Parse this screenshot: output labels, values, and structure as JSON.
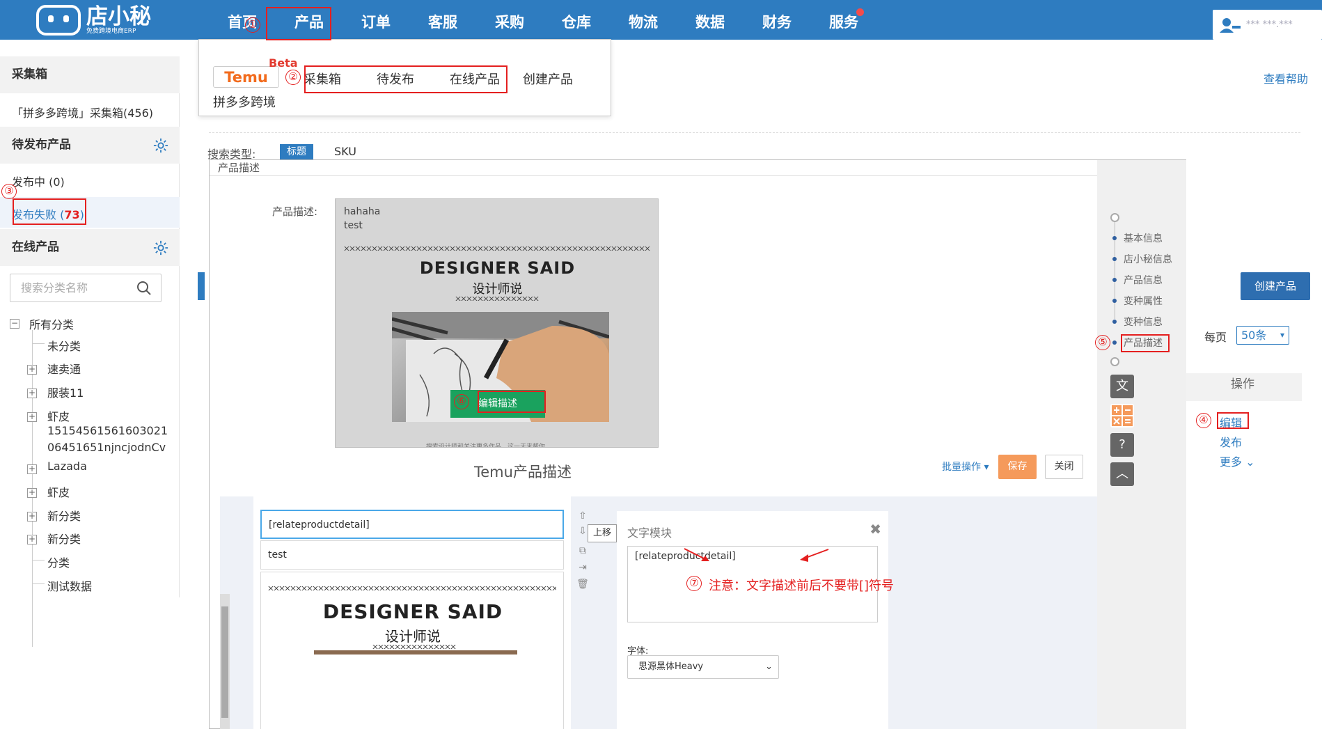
{
  "app": {
    "logo_name": "店小秘",
    "logo_sub": "免费跨境电商ERP",
    "user_name": "*** ***.***"
  },
  "nav": {
    "items": [
      "首页",
      "产品",
      "订单",
      "客服",
      "采购",
      "仓库",
      "物流",
      "数据",
      "财务",
      "服务"
    ]
  },
  "dropdown": {
    "temu_label": "Temu",
    "beta_label": "Beta",
    "items": [
      "采集箱",
      "待发布",
      "在线产品",
      "创建产品"
    ],
    "second_row": "拼多多跨境"
  },
  "sidebar": {
    "collect_header": "采集箱",
    "collect_item": "「拼多多跨境」采集箱(456)",
    "pending_header": "待发布产品",
    "publishing": "发布中 (0)",
    "failed_prefix": "发布失败 (",
    "failed_count": "73",
    "failed_suffix": ")",
    "online_header": "在线产品",
    "search_placeholder": "搜索分类名称",
    "tree": {
      "root": "所有分类",
      "items": [
        "未分类",
        "速卖通",
        "服装11",
        "虾皮",
        "15154561561603021",
        "06451651njncjodnCv",
        "Lazada",
        "虾皮",
        "新分类",
        "新分类",
        "分类",
        "测试数据"
      ]
    }
  },
  "main": {
    "help": "查看帮助",
    "search_type_label": "搜索类型:",
    "search_type_title": "标题",
    "search_type_sku": "SKU",
    "create_product": "创建产品",
    "per_page_label": "每页",
    "per_page_value": "50条",
    "op_header": "操作",
    "op_edit": "编辑",
    "op_publish": "发布",
    "op_more": "更多"
  },
  "modal": {
    "title": "产品描述",
    "desc_label": "产品描述:",
    "desc_line1": "hahaha",
    "desc_line2": "test",
    "ds_title": "DESIGNER SAID",
    "ds_sub": "设计师说",
    "edit_desc": "编辑描述",
    "desc_foot": "搜索设计师和关注更多作品，这一天来帮你",
    "subtitle": "Temu产品描述",
    "batch": "批量操作",
    "save": "保存",
    "close": "关闭",
    "right_nav": [
      "基本信息",
      "店小秘信息",
      "产品信息",
      "变种属性",
      "变种信息",
      "产品描述"
    ]
  },
  "editor": {
    "input1": "[relateproductdetail]",
    "input2": "test",
    "ds_title": "DESIGNER SAID",
    "ds_sub": "设计师说",
    "tooltip": "上移",
    "module_title": "文字模块",
    "module_text": "[relateproductdetail]",
    "font_label": "字体:",
    "font_value": "思源黑体Heavy"
  },
  "annotations": {
    "steps": [
      "①",
      "②",
      "③",
      "④",
      "⑤",
      "⑥",
      "⑦"
    ],
    "note": "注意：文字描述前后不要带[]符号"
  },
  "colors": {
    "brand_blue": "#2e7cc0",
    "annotation_red": "#e41f1f",
    "save_orange": "#f59a5b",
    "edit_green": "#1aa25e",
    "temu_orange": "#f26b1d"
  }
}
